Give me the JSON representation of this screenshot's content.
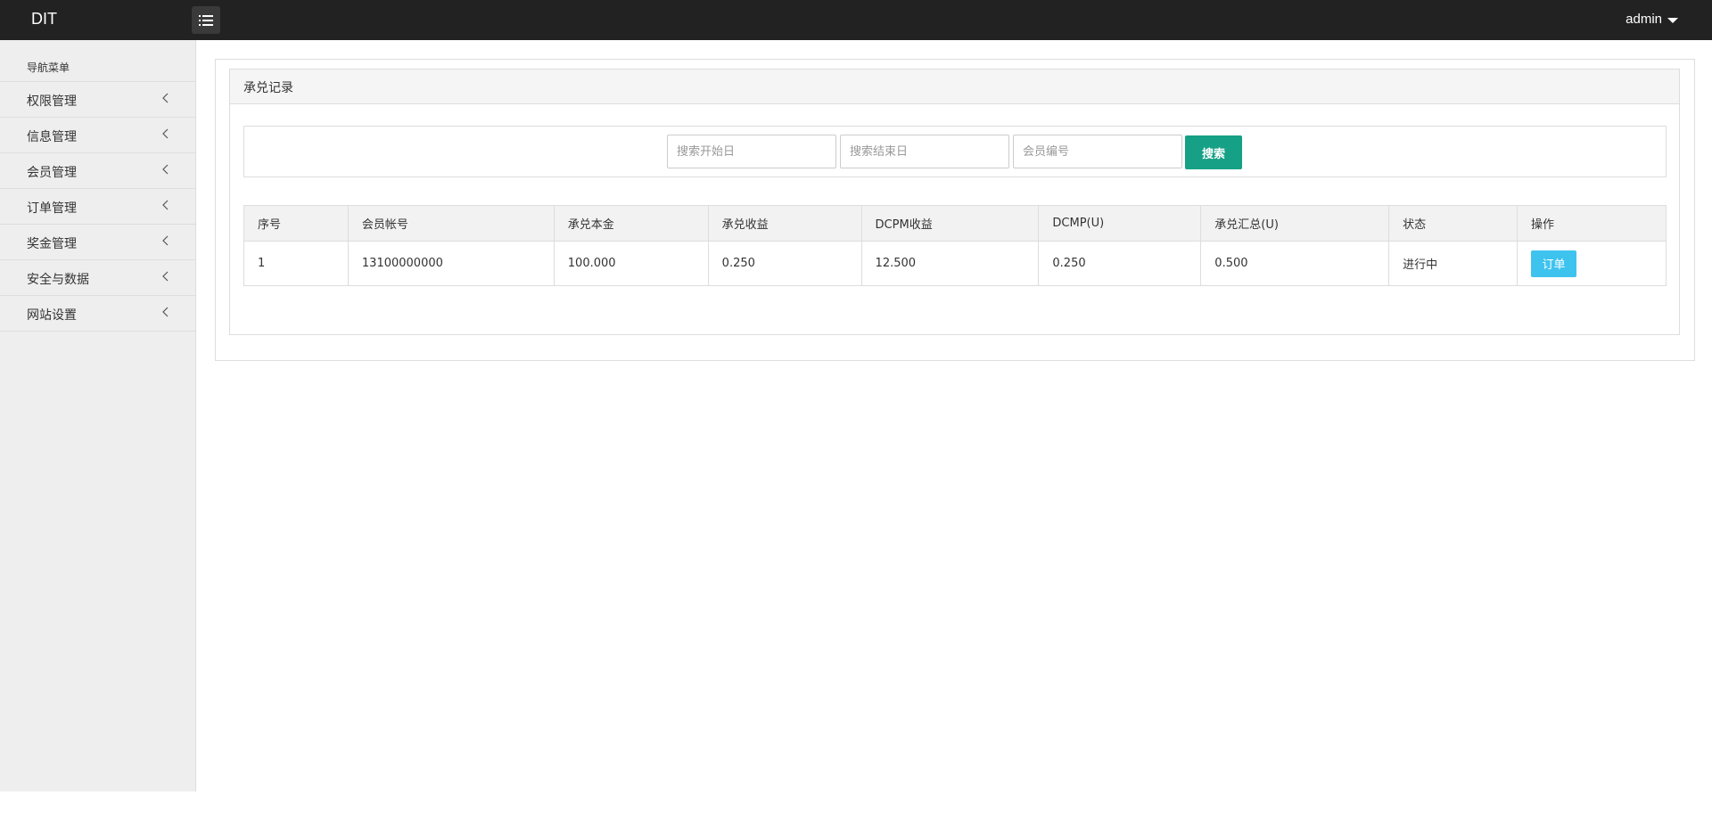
{
  "app": {
    "brand": "DIT",
    "user": "admin"
  },
  "sidebar": {
    "header": "导航菜单",
    "items": [
      {
        "label": "权限管理"
      },
      {
        "label": "信息管理"
      },
      {
        "label": "会员管理"
      },
      {
        "label": "订单管理"
      },
      {
        "label": "奖金管理"
      },
      {
        "label": "安全与数据"
      },
      {
        "label": "网站设置"
      }
    ]
  },
  "panel": {
    "title": "承兑记录"
  },
  "search": {
    "start_placeholder": "搜索开始日",
    "end_placeholder": "搜索结束日",
    "member_placeholder": "会员编号",
    "button_label": "搜索"
  },
  "table": {
    "headers": [
      "序号",
      "会员帐号",
      "承兑本金",
      "承兑收益",
      "DCPM收益",
      "DCMP(U)",
      "承兑汇总(U)",
      "状态",
      "操作"
    ],
    "rows": [
      {
        "index": "1",
        "account": "13100000000",
        "principal": "100.000",
        "income": "0.250",
        "dcpm_income": "12.500",
        "dcmp_u": "0.250",
        "total_u": "0.500",
        "status": "进行中",
        "action": "订单"
      }
    ]
  },
  "colors": {
    "topbar": "#222222",
    "sidebar": "#eeeeee",
    "search_button": "#16a085",
    "order_button": "#3ec3ef"
  }
}
